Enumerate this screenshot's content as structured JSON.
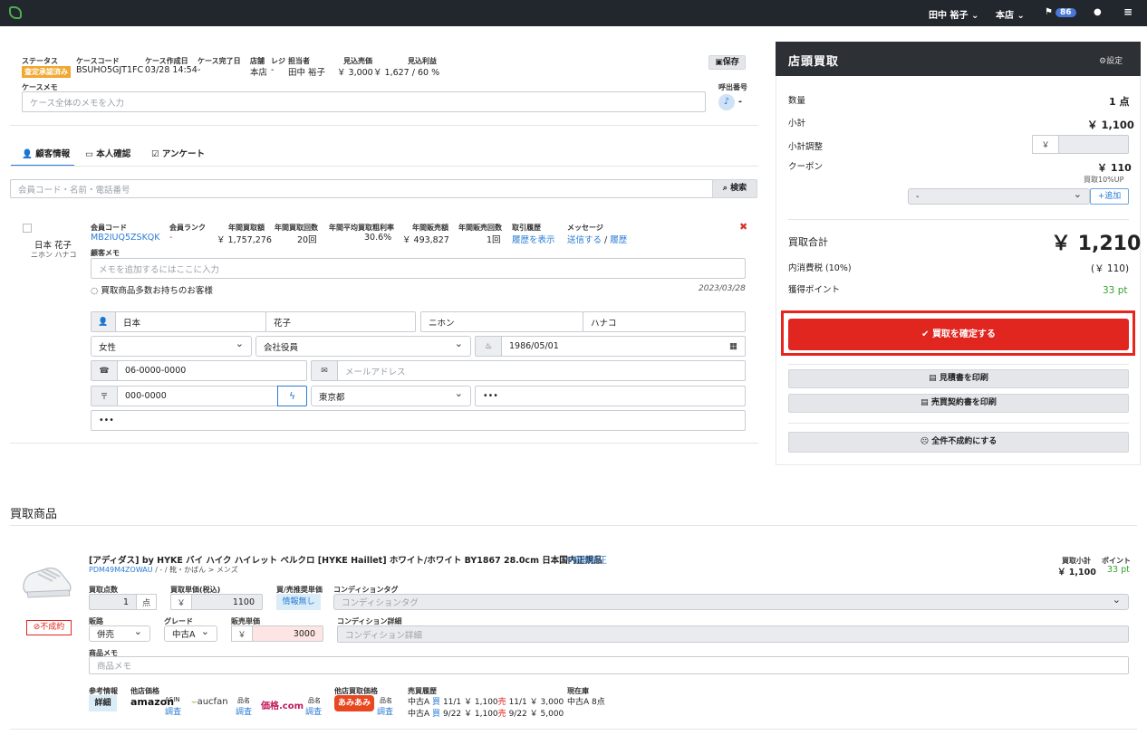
{
  "topbar": {
    "user": "田中 裕子",
    "store": "本店",
    "notifications": "86"
  },
  "case": {
    "headers": [
      "ステータス",
      "ケースコード",
      "ケース作成日",
      "ケース完了日",
      "店舗",
      "レジ",
      "担当者",
      "見込売価",
      "見込利益"
    ],
    "status": "査定承認済み",
    "code": "BSUHO5GJT1FC",
    "created": "03/28 14:54",
    "completed": "-",
    "store": "本店",
    "register": "-",
    "staff": "田中 裕子",
    "expected_price": "￥ 3,000",
    "expected_profit": "￥ 1,627 / 60 %",
    "save_label": "保存",
    "memo_label": "ケースメモ",
    "memo_placeholder": "ケース全体のメモを入力",
    "call_label": "呼出番号",
    "call_value": "-"
  },
  "tabs": [
    "顧客情報",
    "本人確認",
    "アンケート"
  ],
  "search": {
    "placeholder": "会員コード・名前・電話番号",
    "button": "検索"
  },
  "customer": {
    "name": "日本 花子",
    "kana": "ニホン ハナコ",
    "headers": [
      "会員コード",
      "会員ランク",
      "年間買取額",
      "年間買取回数",
      "年間平均買取粗利率",
      "年間販売額",
      "年間販売回数",
      "取引履歴",
      "メッセージ"
    ],
    "code": "MB2IUQ5ZSKQK",
    "rank": "-",
    "annual_buy": "￥ 1,757,276",
    "annual_buy_count": "20回",
    "avg_margin": "30.6%",
    "annual_sales": "￥ 493,827",
    "annual_sales_count": "1回",
    "history_link": "履歴を表示",
    "msg_send": "送信する",
    "msg_sep": "/",
    "msg_history": "履歴",
    "memo_label": "顧客メモ",
    "memo_placeholder": "メモを追加するにはここに入力",
    "note": "買取商品多数お持ちのお客様",
    "note_date": "2023/03/28",
    "last_name": "日本",
    "first_name": "花子",
    "last_kana": "ニホン",
    "first_kana": "ハナコ",
    "gender": "女性",
    "job": "会社役員",
    "birthday": "1986/05/01",
    "phone": "06-0000-0000",
    "email_placeholder": "メールアドレス",
    "zip_prefix": "〒",
    "zip": "000-0000",
    "pref": "東京都",
    "addr1": "•••",
    "addr2": "•••"
  },
  "panel": {
    "title": "店頭買取",
    "settings": "設定",
    "qty_label": "数量",
    "qty": "1 点",
    "subtotal_label": "小計",
    "subtotal": "￥ 1,100",
    "adjust_label": "小計調整",
    "adjust_prefix": "￥",
    "coupon_label": "クーポン",
    "coupon": "￥ 110",
    "coupon_note": "買取10%UP",
    "coupon_select": "-",
    "add_label": "追加",
    "total_label": "買取合計",
    "total": "￥ 1,210",
    "tax_label": "内消費税 (10%)",
    "tax": "(￥ 110)",
    "points_label": "獲得ポイント",
    "points": "33 pt",
    "confirm": "買取を確定する",
    "print_estimate": "見積書を印刷",
    "print_contract": "売買契約書を印刷",
    "reject_all": "全件不成約にする"
  },
  "items_title": "買取商品",
  "item": {
    "title": "[アディダス] by HYKE バイ ハイク ハイレット ベルクロ [HYKE Haillet] ホワイト/ホワイト BY1867 28.0cm 日本国内正規品",
    "edit": "情報修正",
    "code": "PDM49M4ZOWAU",
    "path": "/ - / 靴・かばん > メンズ",
    "reject": "不成約",
    "subtotal_label": "買取小計",
    "subtotal": "￥ 1,100",
    "points_label": "ポイント",
    "points": "33 pt",
    "qty_label": "買取点数",
    "qty": "1",
    "qty_unit": "点",
    "unit_price_label": "買取単価(税込)",
    "unit_price": "1100",
    "yen": "￥",
    "ref_label": "買/売推奨単価",
    "ref_value": "情報無し",
    "cond_tag_label": "コンディションタグ",
    "cond_tag_placeholder": "コンディションタグ",
    "channel_label": "販路",
    "channel": "併売",
    "grade_label": "グレード",
    "grade": "中古A",
    "sale_price_label": "販売単価",
    "sale_price": "3000",
    "cond_detail_label": "コンディション詳細",
    "cond_detail_placeholder": "コンディション詳細",
    "memo_label": "商品メモ",
    "memo_placeholder": "商品メモ",
    "refinfo_label": "参考情報",
    "detail_btn": "詳細",
    "other_price_label": "他店価格",
    "amazon": "amazon",
    "asin": "ASIN",
    "research": "調査",
    "aucfan": "aucfan",
    "kakaku": "価格.com",
    "name_label": "品名",
    "other_buy_label": "他店買取価格",
    "amiami": "あみあみ",
    "history_label": "売買履歴",
    "history": [
      {
        "grade": "中古A",
        "buy": "買",
        "date1": "11/1",
        "price1": "￥ 1,100",
        "sell": "売",
        "date2": "11/1",
        "price2": "￥ 3,000"
      },
      {
        "grade": "中古A",
        "buy": "買",
        "date1": "9/22",
        "price1": "￥ 1,100",
        "sell": "売",
        "date2": "9/22",
        "price2": "￥ 5,000"
      }
    ],
    "stock_label": "現在庫",
    "stock": "中古A 8点"
  }
}
